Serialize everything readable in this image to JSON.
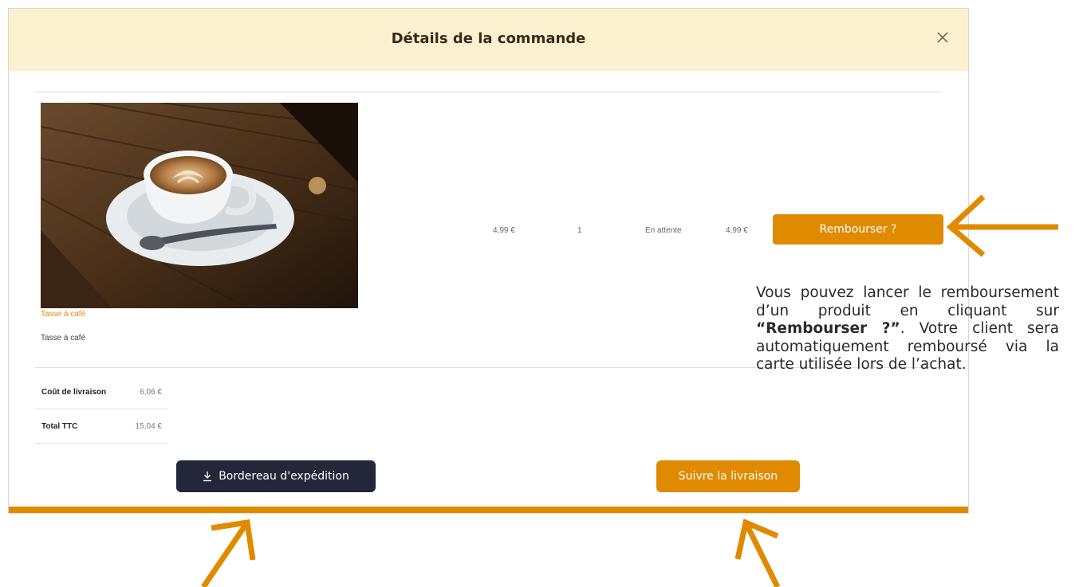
{
  "modal": {
    "title": "Détails de la commande"
  },
  "product": {
    "image_icon": "coffee-cup-photo",
    "link_label": "Tasse à café",
    "name": "Tasse à café",
    "unit_price": "4,99 €",
    "quantity": "1",
    "status": "En attente",
    "total": "4,99 €",
    "refund_button": "Rembourser ?"
  },
  "summary": [
    {
      "label": "Coût de livraison",
      "value": "6,06 €"
    },
    {
      "label": "Total TTC",
      "value": "15,04 €"
    }
  ],
  "actions": {
    "bordereau_icon": "download-icon",
    "bordereau_label": "Bordereau d'expédition",
    "suivre_label": "Suivre la livraison"
  },
  "annotation": {
    "part1": "Vous pouvez lancer le remboursement d’un produit en cliquant sur ",
    "bold": "“Rembourser ?”",
    "part2": ". Votre client sera automatiquement remboursé via la carte utilisée lors de l’achat."
  },
  "colors": {
    "accent": "#e08a00",
    "header_bg": "#fcf1cf",
    "dark_button": "#24273a"
  }
}
